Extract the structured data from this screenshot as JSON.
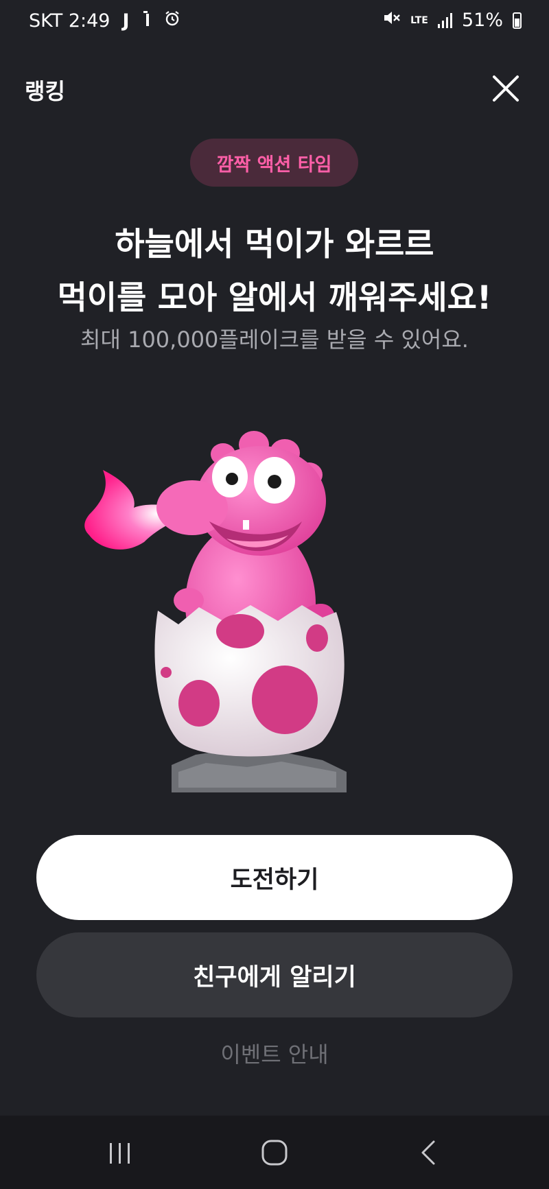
{
  "status_bar": {
    "carrier_time": "SKT 2:49",
    "battery_percent": "51%",
    "network": "LTE",
    "icons": [
      "j-icon",
      "notification-icon",
      "alarm-icon",
      "mute-icon",
      "lte-icon",
      "signal-icon",
      "battery-icon"
    ]
  },
  "header": {
    "title": "랭킹",
    "close_icon": "close-icon"
  },
  "badge": {
    "label": "깜짝 액션 타임"
  },
  "headline": {
    "line1": "하늘에서 먹이가 와르르",
    "line2": "먹이를 모아 알에서 깨워주세요!"
  },
  "subline": "최대 100,000플레이크를 받을 수 있어요.",
  "hero": {
    "illustration": "pink-dragon-hatching-egg-illustration"
  },
  "buttons": {
    "primary": "도전하기",
    "secondary": "친구에게 알리기"
  },
  "event_link": "이벤트 안내",
  "navbar": {
    "icons": [
      "recent-apps-icon",
      "home-icon",
      "back-icon"
    ]
  },
  "colors": {
    "background": "#202126",
    "badge_bg": "#4a2a3a",
    "badge_text": "#ff5fa8",
    "primary_button_bg": "#ffffff",
    "secondary_button_bg": "#36373c",
    "subtle_text": "#a9aab0",
    "link_text": "#6f7076",
    "dragon_pink": "#f05fb0"
  }
}
